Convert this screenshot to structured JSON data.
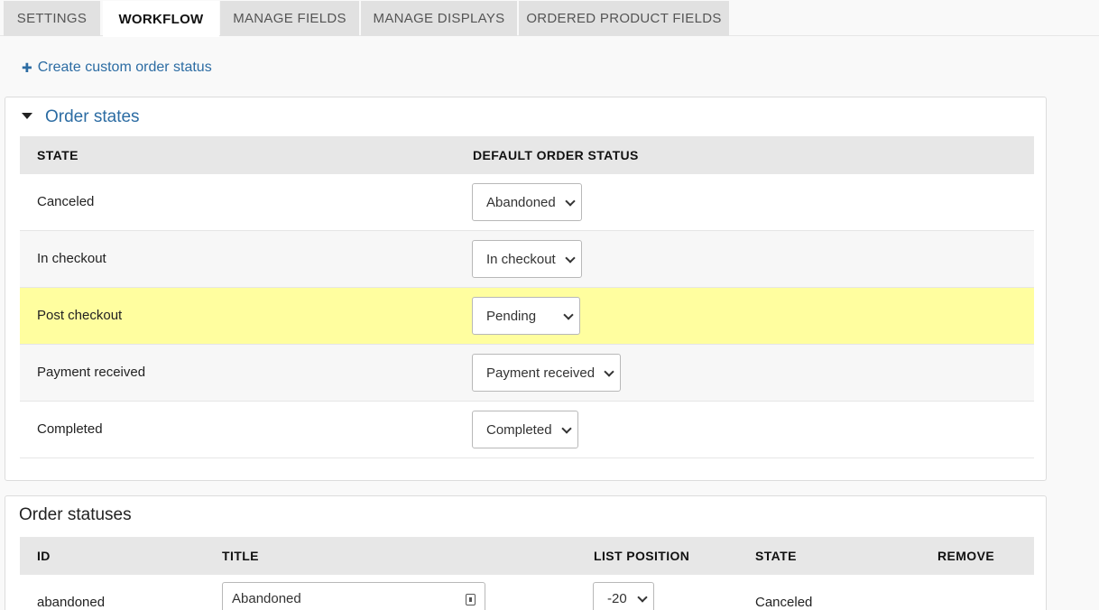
{
  "tabs": [
    {
      "label": "Settings",
      "active": false
    },
    {
      "label": "Workflow",
      "active": true
    },
    {
      "label": "Manage fields",
      "active": false
    },
    {
      "label": "Manage displays",
      "active": false
    },
    {
      "label": "Ordered product fields",
      "active": false
    }
  ],
  "create_link": {
    "icon": "plus-icon",
    "label": "Create custom order status"
  },
  "order_states": {
    "title": "Order states",
    "headers": {
      "state": "State",
      "default_status": "Default order status"
    },
    "rows": [
      {
        "state": "Canceled",
        "default_status": "Abandoned",
        "highlighted": false
      },
      {
        "state": "In checkout",
        "default_status": "In checkout",
        "highlighted": false
      },
      {
        "state": "Post checkout",
        "default_status": "Pending",
        "highlighted": true
      },
      {
        "state": "Payment received",
        "default_status": "Payment received",
        "highlighted": false
      },
      {
        "state": "Completed",
        "default_status": "Completed",
        "highlighted": false
      }
    ]
  },
  "order_statuses": {
    "title": "Order statuses",
    "headers": {
      "id": "ID",
      "title": "Title",
      "list_position": "List position",
      "state": "State",
      "remove": "Remove"
    },
    "rows": [
      {
        "id": "abandoned",
        "title": "Abandoned",
        "list_position": "-20",
        "state": "Canceled"
      }
    ]
  },
  "colors": {
    "link": "#2c6ca3",
    "highlight": "#fffe9f",
    "header_bg": "#e7e7e7"
  }
}
